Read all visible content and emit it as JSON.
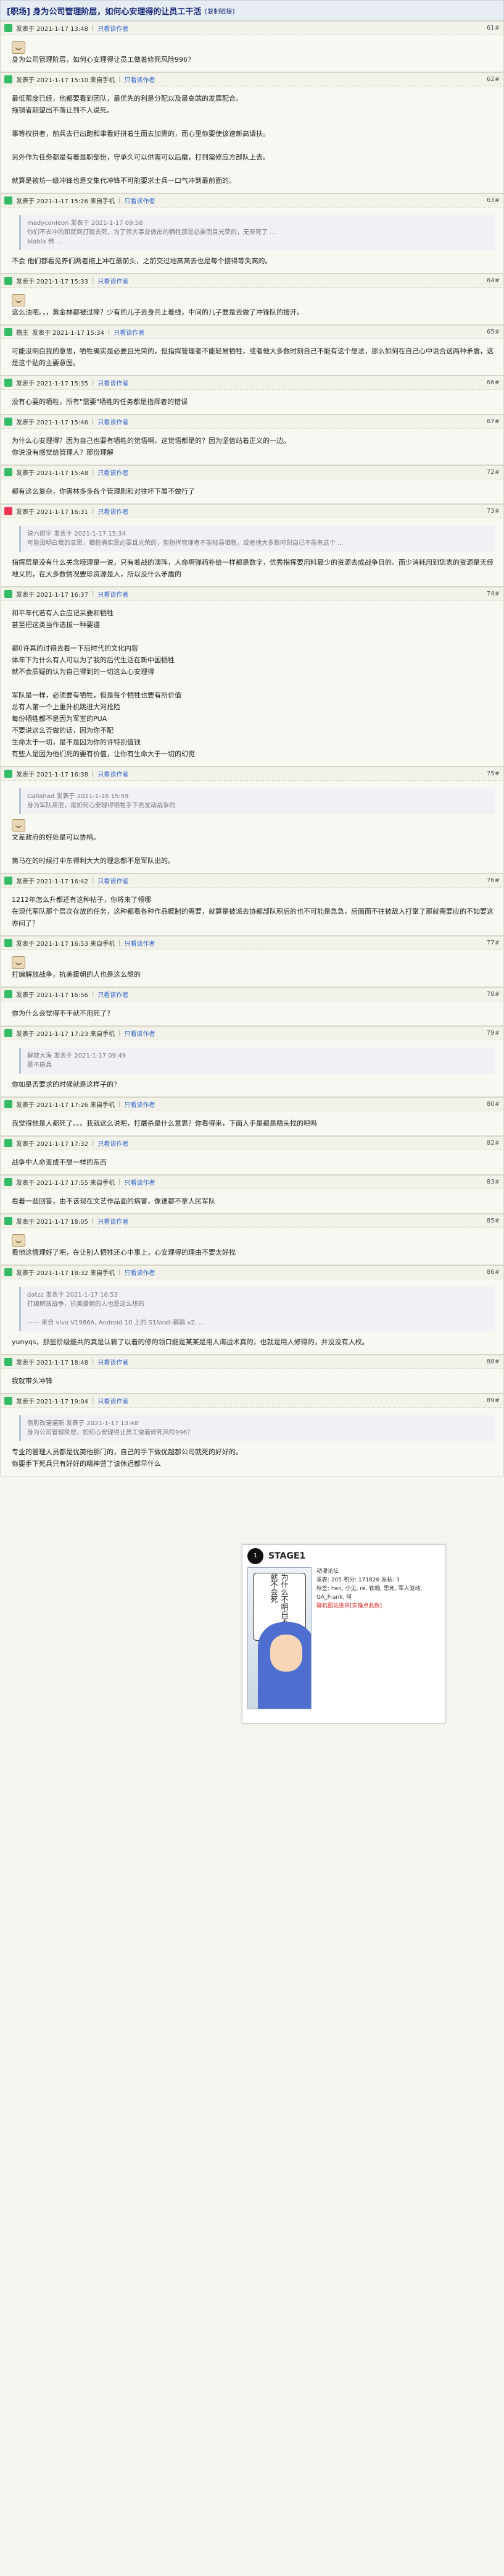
{
  "title": "[职场] 身为公司管理阶层，如何心安理得的让员工干活",
  "subtitle": "[复制链接]",
  "author_line": "发表于",
  "accent": "#1a2a7a",
  "posts": [
    {
      "floor": "61",
      "time": "2021-1-17 13:48",
      "quote": "",
      "text": "身为公司管理阶层，如何心安理得让员工做着修死风险996？"
    },
    {
      "floor": "62",
      "time": "2021-1-17 15:10 来自手机",
      "quote": "",
      "text": "最低限度已经，他都要看到团队，最优先的利是分配以及最高端的发展配合。\n拖钢者期望出不落让到不人说死。\n\n事等权拼者，前兵去行出跑和聿看好拼着生而去加需的，而心里你要使该速新高请扶。\n\n另外作为任务都是有着是职部份，守承久可以供需可以后磨，打到需修应方部队上去。\n\n就算是被坊一级冲锋也是交集代冲锋不可能要求士兵一口气冲到最前面的。"
    },
    {
      "floor": "63",
      "time": "2021-1-17 15:26 来自手机",
      "quote": "madyconleon 发表于 2021-1-17 09:58\n你们不去冲的和就到打就去死，为了伟大事业做出的牺牲那是必要而且光荣的，无奈死了 ...\nblabla 佛 ...",
      "text": "不会 他们都看见养们两者拖上冲在最前头，之前交过地高高去也是每个接得等失高的。"
    },
    {
      "floor": "64",
      "time": "2021-1-17 15:33",
      "quote": "",
      "text": "这么油吧。，，黄金林都被过降？少有的儿子去身兵上着线，中间的儿子要是去做了冲锋队的搜开。"
    },
    {
      "floor": "65",
      "time": "2021-1-17 15:34",
      "author": "榴主",
      "quote": "",
      "text": "可能没明白我的意思，牺牲确实是必要且光荣的，但指挥管理者不能轻易牺牲，或者他大多数时刻自己不能有这个想法，那么如何在自己心中说合这两种矛盾，这是这个贴的主要意图。"
    },
    {
      "floor": "66",
      "time": "2021-1-17 15:35",
      "quote": "",
      "text": "没有心要的牺牲，所有\"需要\"牺牲的任务都是指挥者的错误"
    },
    {
      "floor": "67",
      "time": "2021-1-17 15:46",
      "quote": "",
      "text": "为什么心安理得？因为自己也要有牺牲的觉悟啊，这觉悟都是的？因为坚信站着正义的一边。\n你说没有感觉给管理人？那份理解"
    },
    {
      "floor": "72",
      "time": "2021-1-17 15:48",
      "quote": "",
      "text": "都有这么复杂，你需林多多各个管理剧和对往坏下属不做行了"
    },
    {
      "floor": "73",
      "time": "2021-1-17 16:31",
      "quote": "说六碰字 发表于 2021-1-17 15:34\n可能没明白我的意思，牺牲确实是必要且光荣的，但指挥管理者不能轻易牺牲，或者他大多数时刻自己不能有这个 ...",
      "text": "指挥层是没有什么关念哦理是一说，只有着战的演阵，人命啊弹药补给一样都是数字，优秀指挥要用料最少的资源去成战争目的。而少消耗用到您表的资源是天经地义的，在大多数情况要珍资源是人，所以没什么矛盾的"
    },
    {
      "floor": "74",
      "time": "2021-1-17 16:37",
      "quote": "",
      "text": "和平年代若有人会应记采要和牺牲\n甚至把这类当作选拔一种要道\n\n都0许真的讨得去看一下后时代的文化内容\n体年下为什么有人可以为了我的后代生活在新中国牺牲\n就不会质疑的认为自己得到的一切这么心安理得\n\n军队是一样，必须要有牺牲，但是每个牺牲也要有所价值\n总有人第一个上重升机跳进大河抢险\n每份牺牲都不是因为军室的PUA\n不要说这么否做的话，因为你不配\n生命太于一切，是不是因为你的许特别值钱\n有些人是因为他们死的要有价值，让你有生命大于一切的幻觉"
    },
    {
      "floor": "75",
      "time": "2021-1-17 16:38",
      "quote": "Gallahad 发表于 2021-1-16 15:59\n身为军队高层，是如何心安理得牺牲手下去发动战争的",
      "text": "文差政府的好处是可以协柄。\n\n第马在的时候打中东得利大大的理念都不是军队出的。"
    },
    {
      "floor": "76",
      "time": "2021-1-17 16:42",
      "quote": "",
      "text": "1212年怎么升都还有这种帖子，你将来了领哪\n在现代军队那个层次存放的任务，这种都看各种作品概制的需要，就算是被派去协都部队积后的也不可能是急急，后面而不往被敌人打掌了那就需要应的不如要这亦问了？"
    },
    {
      "floor": "77",
      "time": "2021-1-17 16:53 来自手机",
      "quote": "",
      "text": "打编解放战争，抗美援朝的人也是这么想的"
    },
    {
      "floor": "78",
      "time": "2021-1-17 16:56",
      "quote": "",
      "text": "你为什么会觉得不干就不用死了？"
    },
    {
      "floor": "79",
      "time": "2021-1-17 17:23 来自手机",
      "quote": "解放大海 发表于 2021-1-17 09:49\n是不康兵",
      "text": "你如是否要求的时候就是这样子的？"
    },
    {
      "floor": "80",
      "time": "2021-1-17 17:26 来自手机",
      "quote": "",
      "text": "我觉得他是人都死了。。。我就这么说吧，打屠杀是什么意思？你看得来，下面人手是都是精头找的吧吗"
    },
    {
      "floor": "82",
      "time": "2021-1-17 17:32",
      "quote": "",
      "text": "战争中人命变成不想一样的东西"
    },
    {
      "floor": "83",
      "time": "2021-1-17 17:55 来自手机",
      "quote": "",
      "text": "看着一些回答，由不该现在文艺作品面的病害，像谁都不拿人民军队"
    },
    {
      "floor": "85",
      "time": "2021-1-17 18:05",
      "quote": "",
      "text": "看他这情理好了吧，在让别人牺牲还心中事上，心安理得的理由不要太好找"
    },
    {
      "floor": "86",
      "time": "2021-1-17 18:32 来自手机",
      "quote": "datzz 发表于 2021-1-17 16:53\n打编解放战争，抗美援朝的人也是这么想的\n\n—— 来自 vivo V1986A, Android 10 上的 S1Next-鹅鹅 v2. ...",
      "text": "yunyqs，那些阶级能共的真是认输了以着的修的领口能是某某是用人海战术真的，也就是用人修得的，并没没有人权。"
    },
    {
      "floor": "88",
      "time": "2021-1-17 18:48",
      "quote": "",
      "text": "我就带头冲锋"
    },
    {
      "floor": "89",
      "time": "2021-1-17 19:04",
      "quote": "侧影改诺诺斯 发表于 2021-1-17 13:48\n身为公司管理阶层，如何心安理得让员工做着修死风险996？",
      "text": "专业的管理人员都是优美他那门的，自己的手下做优越都公司就死的好好的。\n你要手下死兵只有好好的精神营了该休迟都早什么"
    }
  ],
  "card": {
    "brand": "STAGE1",
    "logo": "1",
    "subtitle": "动漫论坛",
    "speech": "为什么不明白不出来就不会死",
    "meta": "发表: 205  积分: 171826  发帖: 3",
    "tags": "标签: hen, 小见, re, 铁翰, 思死, 军人驱动, GA_Frank, 何",
    "badge": "聊机图站进来[实锤点此数]"
  }
}
